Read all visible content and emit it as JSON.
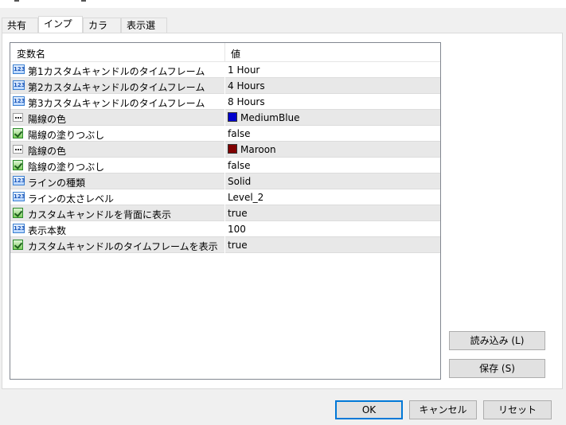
{
  "tabs": [
    "共有",
    "インプット",
    "カラー",
    "表示選択"
  ],
  "grid": {
    "col_name": "変数名",
    "col_value": "値",
    "rows": [
      {
        "icon": "number-icon",
        "name": "第1カスタムキャンドルのタイムフレーム",
        "value": "1 Hour"
      },
      {
        "icon": "number-icon",
        "name": "第2カスタムキャンドルのタイムフレーム",
        "value": "4 Hours"
      },
      {
        "icon": "number-icon",
        "name": "第3カスタムキャンドルのタイムフレーム",
        "value": "8 Hours"
      },
      {
        "icon": "color-icon",
        "name": "陽線の色",
        "value": "MediumBlue",
        "swatch": "#0000cd"
      },
      {
        "icon": "boolean-icon",
        "name": "陽線の塗りつぶし",
        "value": "false"
      },
      {
        "icon": "color-icon",
        "name": "陰線の色",
        "value": "Maroon",
        "swatch": "#800000"
      },
      {
        "icon": "boolean-icon",
        "name": "陰線の塗りつぶし",
        "value": "false"
      },
      {
        "icon": "number-icon",
        "name": "ラインの種類",
        "value": "Solid"
      },
      {
        "icon": "number-icon",
        "name": "ラインの太さレベル",
        "value": "Level_2"
      },
      {
        "icon": "boolean-icon",
        "name": "カスタムキャンドルを背面に表示",
        "value": "true"
      },
      {
        "icon": "number-icon",
        "name": "表示本数",
        "value": "100"
      },
      {
        "icon": "boolean-icon",
        "name": "カスタムキャンドルのタイムフレームを表示",
        "value": "true"
      }
    ]
  },
  "buttons": {
    "load": "読み込み (L)",
    "save": "保存 (S)",
    "ok": "OK",
    "cancel": "キャンセル",
    "reset": "リセット"
  },
  "colors": {
    "accent": "#0078d7",
    "row_alt": "#e8e8e8"
  }
}
